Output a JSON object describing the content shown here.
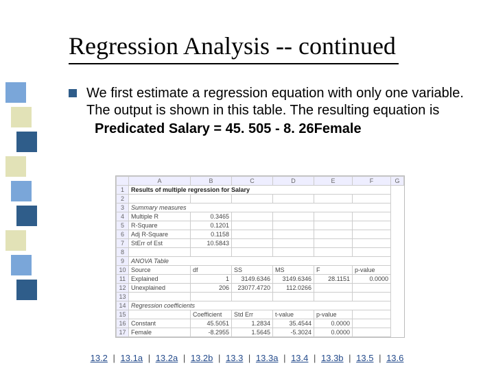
{
  "title": "Regression Analysis -- continued",
  "bullet_text": "We first estimate a regression equation with only one variable. The output is shown in this table. The resulting equation is",
  "equation": "Predicated Salary = 45. 505 - 8. 26Female",
  "sheet": {
    "col_headers": [
      "",
      "A",
      "B",
      "C",
      "D",
      "E",
      "F",
      "G"
    ],
    "rows": [
      {
        "n": "1",
        "A": "Results of multiple regression for Salary"
      },
      {
        "n": "2"
      },
      {
        "n": "3",
        "A": "Summary measures",
        "A_ital": true
      },
      {
        "n": "4",
        "B": "Multiple R",
        "C": "0.3465"
      },
      {
        "n": "5",
        "B": "R-Square",
        "C": "0.1201"
      },
      {
        "n": "6",
        "B": "Adj R-Square",
        "C": "0.1158"
      },
      {
        "n": "7",
        "B": "StErr of Est",
        "C": "10.5843"
      },
      {
        "n": "8"
      },
      {
        "n": "9",
        "A": "ANOVA Table",
        "A_ital": true
      },
      {
        "n": "10",
        "B": "Source",
        "C": "df",
        "D": "SS",
        "E": "MS",
        "F": "F",
        "G": "p-value"
      },
      {
        "n": "11",
        "B": "Explained",
        "C": "1",
        "D": "3149.6346",
        "E": "3149.6346",
        "F": "28.1151",
        "G": "0.0000"
      },
      {
        "n": "12",
        "B": "Unexplained",
        "C": "206",
        "D": "23077.4720",
        "E": "112.0266"
      },
      {
        "n": "13"
      },
      {
        "n": "14",
        "A": "Regression coefficients",
        "A_ital": true
      },
      {
        "n": "15",
        "C": "Coefficient",
        "D": "Std Err",
        "E": "t-value",
        "F": "p-value"
      },
      {
        "n": "16",
        "B": "Constant",
        "C": "45.5051",
        "D": "1.2834",
        "E": "35.4544",
        "F": "0.0000"
      },
      {
        "n": "17",
        "B": "Female",
        "C": "-8.2955",
        "D": "1.5645",
        "E": "-5.3024",
        "F": "0.0000"
      }
    ]
  },
  "footer_links": [
    "13.2",
    "13.1a",
    "13.2a",
    "13.2b",
    "13.3",
    "13.3a",
    "13.4",
    "13.3b",
    "13.5",
    "13.6"
  ],
  "chart_data": {
    "type": "table",
    "title": "Results of multiple regression for Salary",
    "summary_measures": {
      "Multiple R": 0.3465,
      "R-Square": 0.1201,
      "Adj R-Square": 0.1158,
      "StErr of Est": 10.5843
    },
    "anova": {
      "columns": [
        "Source",
        "df",
        "SS",
        "MS",
        "F",
        "p-value"
      ],
      "rows": [
        {
          "Source": "Explained",
          "df": 1,
          "SS": 3149.6346,
          "MS": 3149.6346,
          "F": 28.1151,
          "p-value": 0.0
        },
        {
          "Source": "Unexplained",
          "df": 206,
          "SS": 23077.472,
          "MS": 112.0266
        }
      ]
    },
    "coefficients": {
      "columns": [
        "",
        "Coefficient",
        "Std Err",
        "t-value",
        "p-value"
      ],
      "rows": [
        {
          "name": "Constant",
          "Coefficient": 45.5051,
          "Std Err": 1.2834,
          "t-value": 35.4544,
          "p-value": 0.0
        },
        {
          "name": "Female",
          "Coefficient": -8.2955,
          "Std Err": 1.5645,
          "t-value": -5.3024,
          "p-value": 0.0
        }
      ]
    }
  },
  "art_colors": [
    "#7aa6d9",
    "#e2e2b7",
    "#2f5d8a",
    "#e2e2b7",
    "#7aa6d9",
    "#2f5d8a",
    "#e2e2b7",
    "#7aa6d9",
    "#2f5d8a"
  ]
}
